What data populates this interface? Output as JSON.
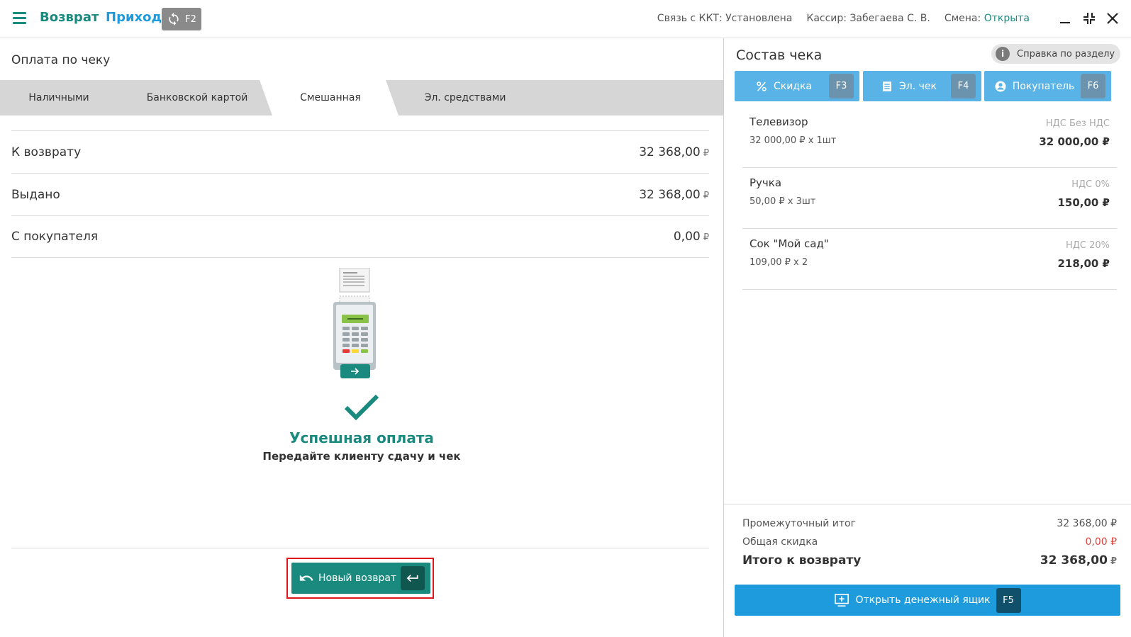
{
  "header": {
    "mode_return": "Возврат",
    "mode_income": "Приход",
    "sync_key": "F2",
    "status_kkt_label": "Связь с ККТ:",
    "status_kkt_value": "Установлена",
    "cashier_label": "Кассир:",
    "cashier_value": "Забегаева С. В.",
    "shift_label": "Смена:",
    "shift_value": "Открыта"
  },
  "payment": {
    "title": "Оплата по чеку",
    "tabs": [
      "Наличными",
      "Банковской картой",
      "Смешанная",
      "Эл. средствами"
    ],
    "active_tab": "Смешанная",
    "rows": [
      {
        "label": "К возврату",
        "value": "32 368,00"
      },
      {
        "label": "Выдано",
        "value": "32 368,00"
      },
      {
        "label": "С покупателя",
        "value": "0,00"
      }
    ],
    "currency": "₽",
    "success_title": "Успешная оплата",
    "success_subtitle": "Передайте клиенту сдачу и чек",
    "new_return_label": "Новый возврат"
  },
  "receipt": {
    "title": "Состав чека",
    "help_label": "Справка по разделу",
    "help_icon": "i",
    "actions": [
      {
        "label": "Скидка",
        "key": "F3",
        "icon": "percent-icon"
      },
      {
        "label": "Эл. чек",
        "key": "F4",
        "icon": "list-icon"
      },
      {
        "label": "Покупатель",
        "key": "F6",
        "icon": "user-icon"
      }
    ],
    "items": [
      {
        "name": "Телевизор",
        "qty": "32 000,00 ₽ x 1шт",
        "vat": "НДС Без НДС",
        "sum": "32 000,00 ₽"
      },
      {
        "name": "Ручка",
        "qty": "50,00 ₽ x 3шт",
        "vat": "НДС 0%",
        "sum": "150,00 ₽"
      },
      {
        "name": "Сок \"Мой сад\"",
        "qty": "109,00 ₽ x 2",
        "vat": "НДС 20%",
        "sum": "218,00 ₽"
      }
    ],
    "subtotal_label": "Промежуточный итог",
    "subtotal_value": "32 368,00 ₽",
    "discount_label": "Общая скидка",
    "discount_value": "0,00 ₽",
    "total_label": "Итого к возврату",
    "total_value": "32 368,00",
    "currency": "₽",
    "cash_drawer_label": "Открыть денежный ящик",
    "cash_drawer_key": "F5"
  },
  "colors": {
    "accent_green": "#1a8a7f",
    "accent_blue": "#1e9bdc",
    "action_blue": "#5ab3e6",
    "highlight_red": "#e0161c"
  }
}
